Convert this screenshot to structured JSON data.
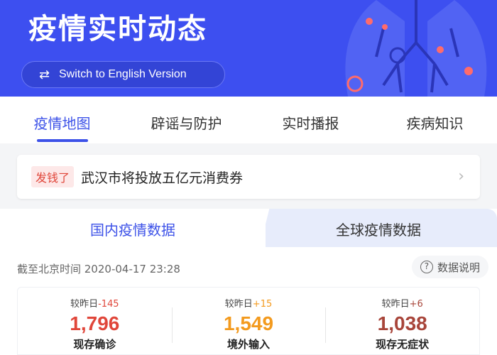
{
  "colors": {
    "brand": "#3d4ff0",
    "accent": "#3d52e8",
    "red": "#e0463a",
    "orange": "#f39a1e",
    "brown": "#a8453a"
  },
  "banner": {
    "title": "疫情实时动态",
    "switch_label": "Switch to English Version",
    "switch_icon": "swap-arrows-icon"
  },
  "tabs": [
    {
      "label": "疫情地图",
      "active": true
    },
    {
      "label": "辟谣与防护",
      "active": false
    },
    {
      "label": "实时播报",
      "active": false
    },
    {
      "label": "疾病知识",
      "active": false
    }
  ],
  "news": {
    "tag": "发钱了",
    "text": "武汉市将投放五亿元消费券",
    "arrow_icon": "chevron-right-icon"
  },
  "panel": {
    "tab_domestic": "国内疫情数据",
    "tab_global": "全球疫情数据",
    "timestamp": "截至北京时间 2020-04-17 23:28",
    "explain_label": "数据说明"
  },
  "stats": [
    {
      "delta_label": "较昨日",
      "delta": "-145",
      "value": "1,796",
      "label": "现存确诊"
    },
    {
      "delta_label": "较昨日",
      "delta": "+15",
      "value": "1,549",
      "label": "境外输入"
    },
    {
      "delta_label": "较昨日",
      "delta": "+6",
      "value": "1,038",
      "label": "现存无症状"
    }
  ]
}
